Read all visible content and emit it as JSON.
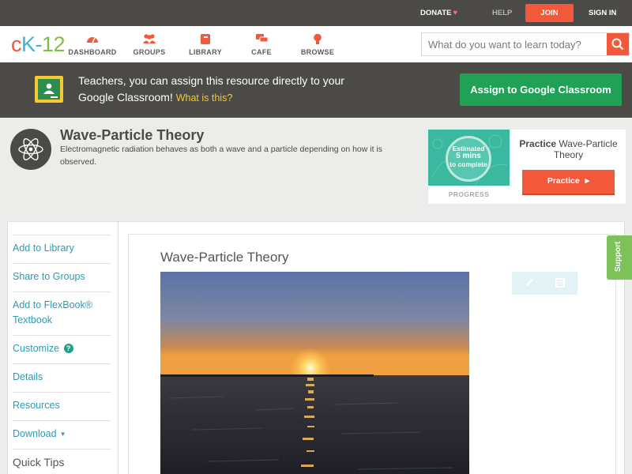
{
  "topbar": {
    "donate": "DONATE",
    "help": "HELP",
    "join": "JOIN",
    "signin": "SIGN IN"
  },
  "nav": {
    "logo": {
      "c": "c",
      "k": "K",
      "dash": "-",
      "n": "12"
    },
    "items": [
      {
        "label": "DASHBOARD",
        "icon": "dashboard-icon"
      },
      {
        "label": "GROUPS",
        "icon": "groups-icon"
      },
      {
        "label": "LIBRARY",
        "icon": "library-icon"
      },
      {
        "label": "CAFE",
        "icon": "cafe-icon"
      },
      {
        "label": "BROWSE",
        "icon": "browse-icon"
      }
    ],
    "search_placeholder": "What do you want to learn today?"
  },
  "banner": {
    "message": "Teachers, you can assign this resource directly to your Google Classroom!",
    "what_link": "What is this?",
    "assign_button": "Assign to Google Classroom"
  },
  "concept": {
    "title": "Wave-Particle Theory",
    "description": "Electromagnetic radiation behaves as both a wave and a particle depending on how it is observed."
  },
  "practice": {
    "estimated": "Estimated",
    "mins": "5 mins",
    "to_complete": "to complete",
    "progress_label": "PROGRESS",
    "title_bold": "Practice",
    "title_rest": "Wave-Particle Theory",
    "button": "Practice"
  },
  "sidebar": {
    "items": [
      {
        "label": "Add to Library"
      },
      {
        "label": "Share to Groups"
      },
      {
        "label": "Add to FlexBook® Textbook"
      },
      {
        "label": "Customize"
      },
      {
        "label": "Details"
      },
      {
        "label": "Resources"
      },
      {
        "label": "Download"
      }
    ],
    "quick_tips": "Quick Tips"
  },
  "content": {
    "title": "Wave-Particle Theory"
  },
  "support": "Support",
  "colors": {
    "orange": "#f2593a",
    "green": "#21a155",
    "teal": "#2e9ab2",
    "dark": "#4b4a47"
  }
}
